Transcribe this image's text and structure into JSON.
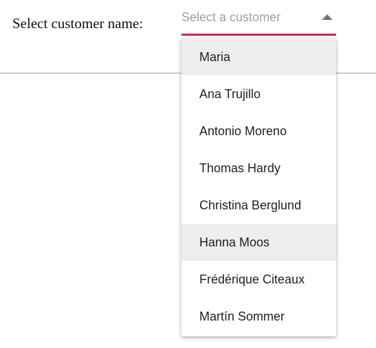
{
  "form": {
    "label": "Select customer name:"
  },
  "dropdown": {
    "placeholder": "Select a customer",
    "state": "open",
    "accent_color": "#e3165b",
    "icon": "caret-up-icon",
    "options": [
      {
        "label": "Maria",
        "highlighted": true
      },
      {
        "label": "Ana Trujillo",
        "highlighted": false
      },
      {
        "label": "Antonio Moreno",
        "highlighted": false
      },
      {
        "label": "Thomas Hardy",
        "highlighted": false
      },
      {
        "label": "Christina Berglund",
        "highlighted": false
      },
      {
        "label": "Hanna Moos",
        "highlighted": true
      },
      {
        "label": "Frédérique Citeaux",
        "highlighted": false
      },
      {
        "label": "Martín Sommer",
        "highlighted": false
      }
    ]
  }
}
